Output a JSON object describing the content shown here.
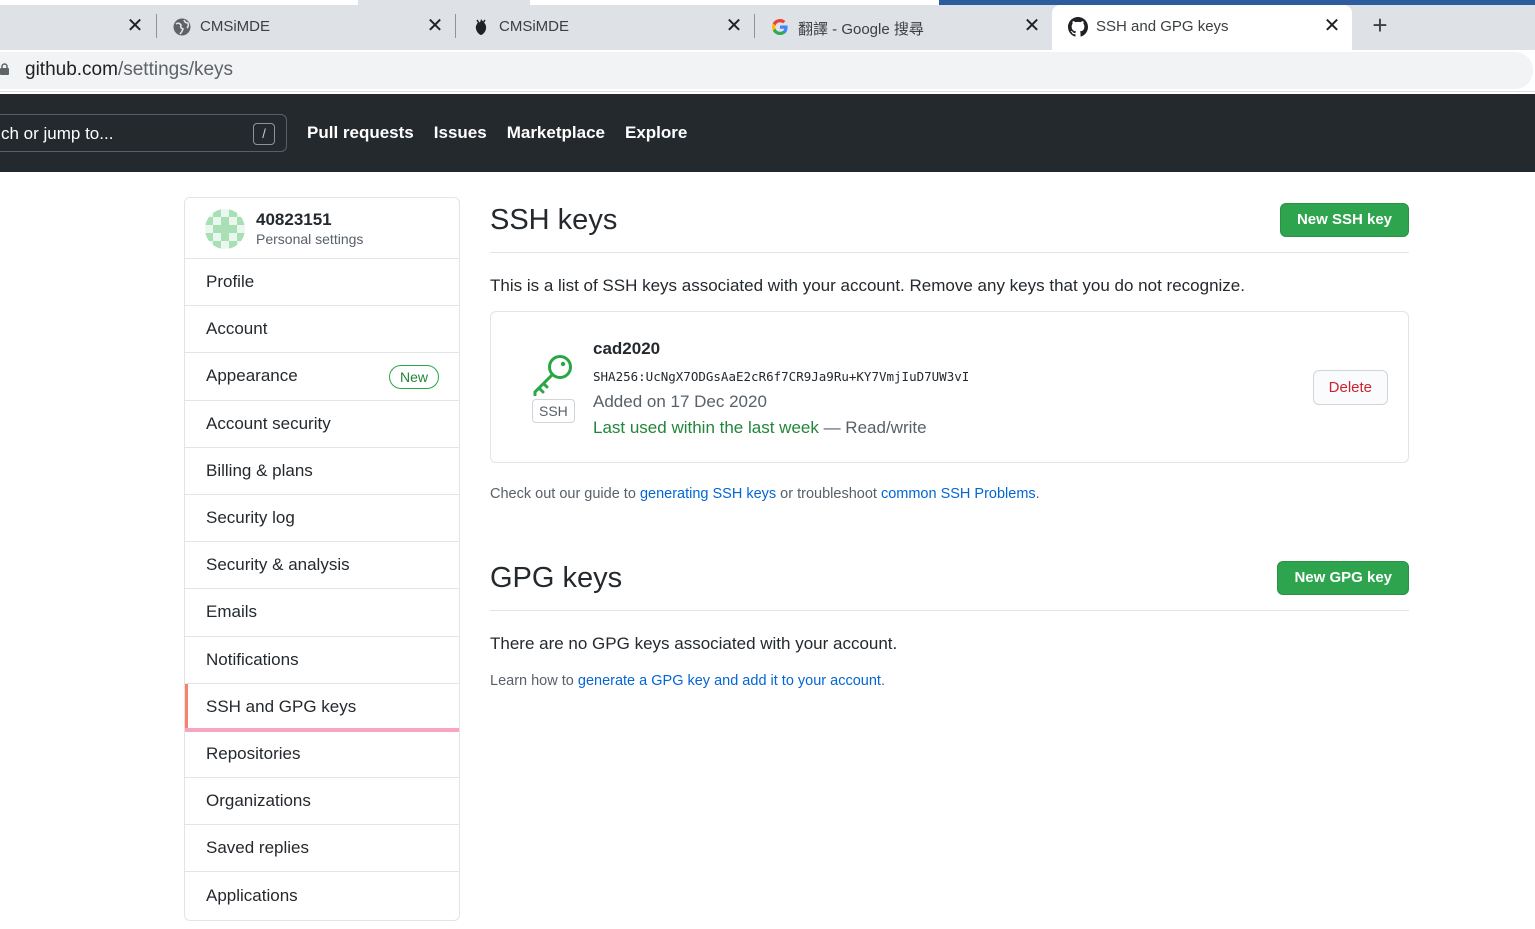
{
  "browser": {
    "tabs": [
      {
        "title": ""
      },
      {
        "title": "CMSiMDE"
      },
      {
        "title": "CMSiMDE"
      },
      {
        "title": "翻譯 - Google 搜尋"
      },
      {
        "title": "SSH and GPG keys"
      }
    ],
    "new_tab": "+",
    "close": "✕",
    "url_host": "github.com",
    "url_path": "/settings/keys"
  },
  "header": {
    "search_placeholder": "ch or jump to...",
    "search_shortcut": "/",
    "nav": [
      "Pull requests",
      "Issues",
      "Marketplace",
      "Explore"
    ]
  },
  "sidebar": {
    "username": "40823151",
    "subtitle": "Personal settings",
    "items": [
      {
        "label": "Profile"
      },
      {
        "label": "Account"
      },
      {
        "label": "Appearance",
        "badge": "New"
      },
      {
        "label": "Account security"
      },
      {
        "label": "Billing & plans"
      },
      {
        "label": "Security log"
      },
      {
        "label": "Security & analysis"
      },
      {
        "label": "Emails"
      },
      {
        "label": "Notifications"
      },
      {
        "label": "SSH and GPG keys"
      },
      {
        "label": "Repositories"
      },
      {
        "label": "Organizations"
      },
      {
        "label": "Saved replies"
      },
      {
        "label": "Applications"
      }
    ]
  },
  "ssh": {
    "title": "SSH keys",
    "new_button": "New SSH key",
    "description": "This is a list of SSH keys associated with your account. Remove any keys that you do not recognize.",
    "key": {
      "type_label": "SSH",
      "name": "cad2020",
      "fingerprint": "SHA256:UcNgX7ODGsAaE2cR6f7CR9Ja9Ru+KY7VmjIuD7UW3vI",
      "added": "Added on 17 Dec 2020",
      "last_used": "Last used within the last week",
      "access": " — Read/write",
      "delete_button": "Delete"
    },
    "guide_prefix": "Check out our guide to ",
    "guide_link1": "generating SSH keys",
    "guide_mid": " or troubleshoot ",
    "guide_link2": "common SSH Problems",
    "guide_suffix": "."
  },
  "gpg": {
    "title": "GPG keys",
    "new_button": "New GPG key",
    "description": "There are no GPG keys associated with your account.",
    "learn_prefix": "Learn how to ",
    "learn_link": "generate a GPG key and add it to your account",
    "learn_suffix": "."
  },
  "colors": {
    "header_bg": "#24292e",
    "primary_green": "#2ea44f",
    "link_blue": "#0366d6",
    "danger_red": "#cb2431",
    "selected_accent": "#f9826c"
  }
}
